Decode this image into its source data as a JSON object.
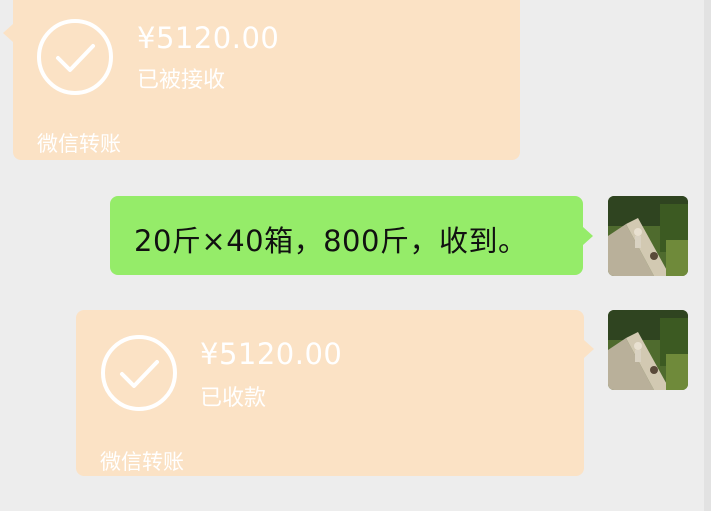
{
  "messages": [
    {
      "type": "transfer",
      "direction": "incoming",
      "amount": "¥5120.00",
      "status": "已被接收",
      "label": "微信转账"
    },
    {
      "type": "text",
      "direction": "outgoing",
      "text": "20斤×40箱，800斤，收到。"
    },
    {
      "type": "transfer",
      "direction": "outgoing",
      "amount": "¥5120.00",
      "status": "已收款",
      "label": "微信转账"
    }
  ],
  "icons": {
    "transfer_status": "check-circle-icon"
  },
  "colors": {
    "background": "#ededed",
    "transfer_bubble": "#fbe2c5",
    "text_bubble": "#95ec69",
    "transfer_text": "#ffffff"
  }
}
